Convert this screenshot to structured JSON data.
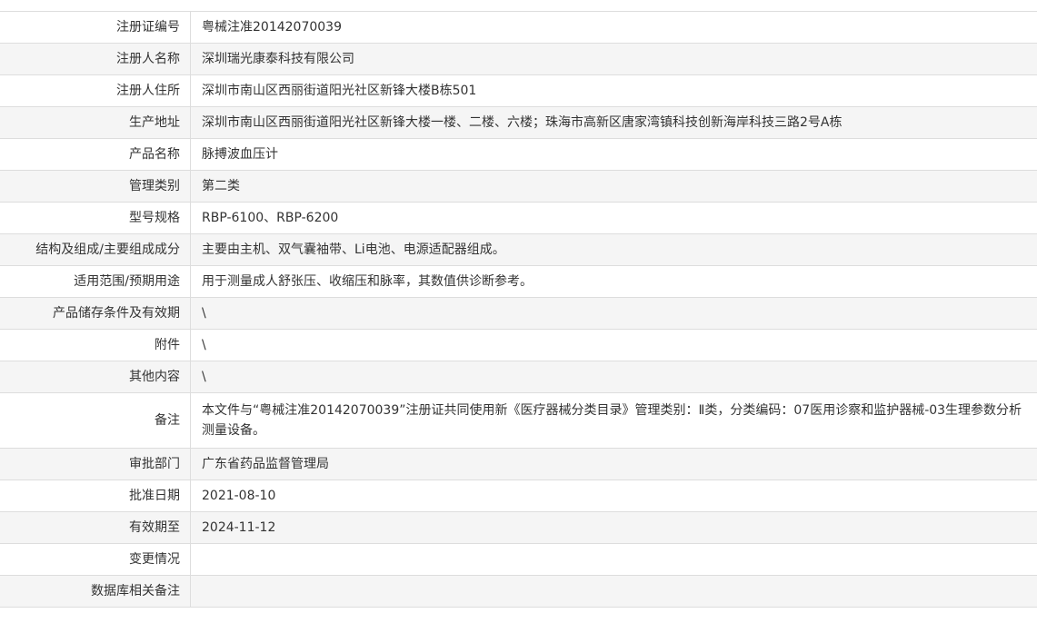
{
  "rows": [
    {
      "label": "注册证编号",
      "value": "粤械注准20142070039"
    },
    {
      "label": "注册人名称",
      "value": "深圳瑞光康泰科技有限公司"
    },
    {
      "label": "注册人住所",
      "value": "深圳市南山区西丽街道阳光社区新锋大楼B栋501"
    },
    {
      "label": "生产地址",
      "value": "深圳市南山区西丽街道阳光社区新锋大楼一楼、二楼、六楼；珠海市高新区唐家湾镇科技创新海岸科技三路2号A栋"
    },
    {
      "label": "产品名称",
      "value": "脉搏波血压计"
    },
    {
      "label": "管理类别",
      "value": "第二类"
    },
    {
      "label": "型号规格",
      "value": "RBP-6100、RBP-6200"
    },
    {
      "label": "结构及组成/主要组成成分",
      "value": "主要由主机、双气囊袖带、Li电池、电源适配器组成。"
    },
    {
      "label": "适用范围/预期用途",
      "value": "用于测量成人舒张压、收缩压和脉率，其数值供诊断参考。"
    },
    {
      "label": "产品储存条件及有效期",
      "value": "\\"
    },
    {
      "label": "附件",
      "value": "\\"
    },
    {
      "label": "其他内容",
      "value": "\\"
    },
    {
      "label": "备注",
      "value": "本文件与“粤械注准20142070039”注册证共同使用新《医疗器械分类目录》管理类别：Ⅱ类，分类编码：07医用诊察和监护器械-03生理参数分析测量设备。"
    },
    {
      "label": "审批部门",
      "value": "广东省药品监督管理局"
    },
    {
      "label": "批准日期",
      "value": "2021-08-10"
    },
    {
      "label": "有效期至",
      "value": "2024-11-12"
    },
    {
      "label": "变更情况",
      "value": ""
    },
    {
      "label": "数据库相关备注",
      "value": ""
    }
  ]
}
